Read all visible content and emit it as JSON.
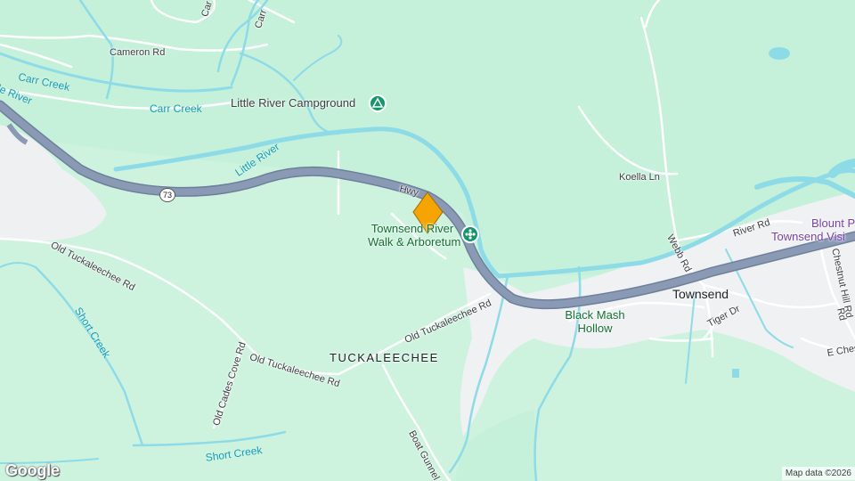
{
  "map": {
    "logo": "Google",
    "credit": "Map data ©2026",
    "colors": {
      "land": "#c5f0d9",
      "water": "#8edbe8",
      "road": "#ffffff",
      "highway": "#8a9ab5",
      "town": "#eff1f3",
      "marker": "#f6a500"
    },
    "roads": {
      "cameron_rd": "Cameron Rd",
      "koella_ln": "Koella Ln",
      "webb_rd": "Webb Rd",
      "river_rd": "River Rd",
      "tiger_dr": "Tiger Dr",
      "chestnut_hill_rd": "Chestnut Hill Rd",
      "e_chest": "E Chest",
      "old_tuckaleechee_rd_1": "Old Tuckaleechee Rd",
      "old_tuckaleechee_rd_2": "Old Tuckaleechee Rd",
      "old_tuckaleechee_rd_3": "Old Tuckaleechee Rd",
      "old_cades_cove_rd": "Old Cades Cove Rd",
      "boat_gunnel_rd": "Boat Gunnel Rd",
      "hwy": "Hwy",
      "carr_top": "Carr",
      "car_top": "Car",
      "rd_frag": "Rd"
    },
    "route_shield": "73",
    "waters": {
      "carr_creek_1": "Carr Creek",
      "carr_creek_2": "Carr Creek",
      "little_river_1": "Little River",
      "little_river_2": "le River",
      "short_creek_1": "Short Creek",
      "short_creek_2": "Short Creek"
    },
    "pois": {
      "campground": "Little River Campground",
      "river_walk_line1": "Townsend River",
      "river_walk_line2": "Walk & Arboretum",
      "black_mash_line1": "Black Mash",
      "black_mash_line2": "Hollow",
      "blount_line1": "Blount P",
      "blount_line2": "Townsend Visi"
    },
    "places": {
      "townsend": "Townsend",
      "tuckaleechee": "TUCKALEECHEE"
    }
  }
}
